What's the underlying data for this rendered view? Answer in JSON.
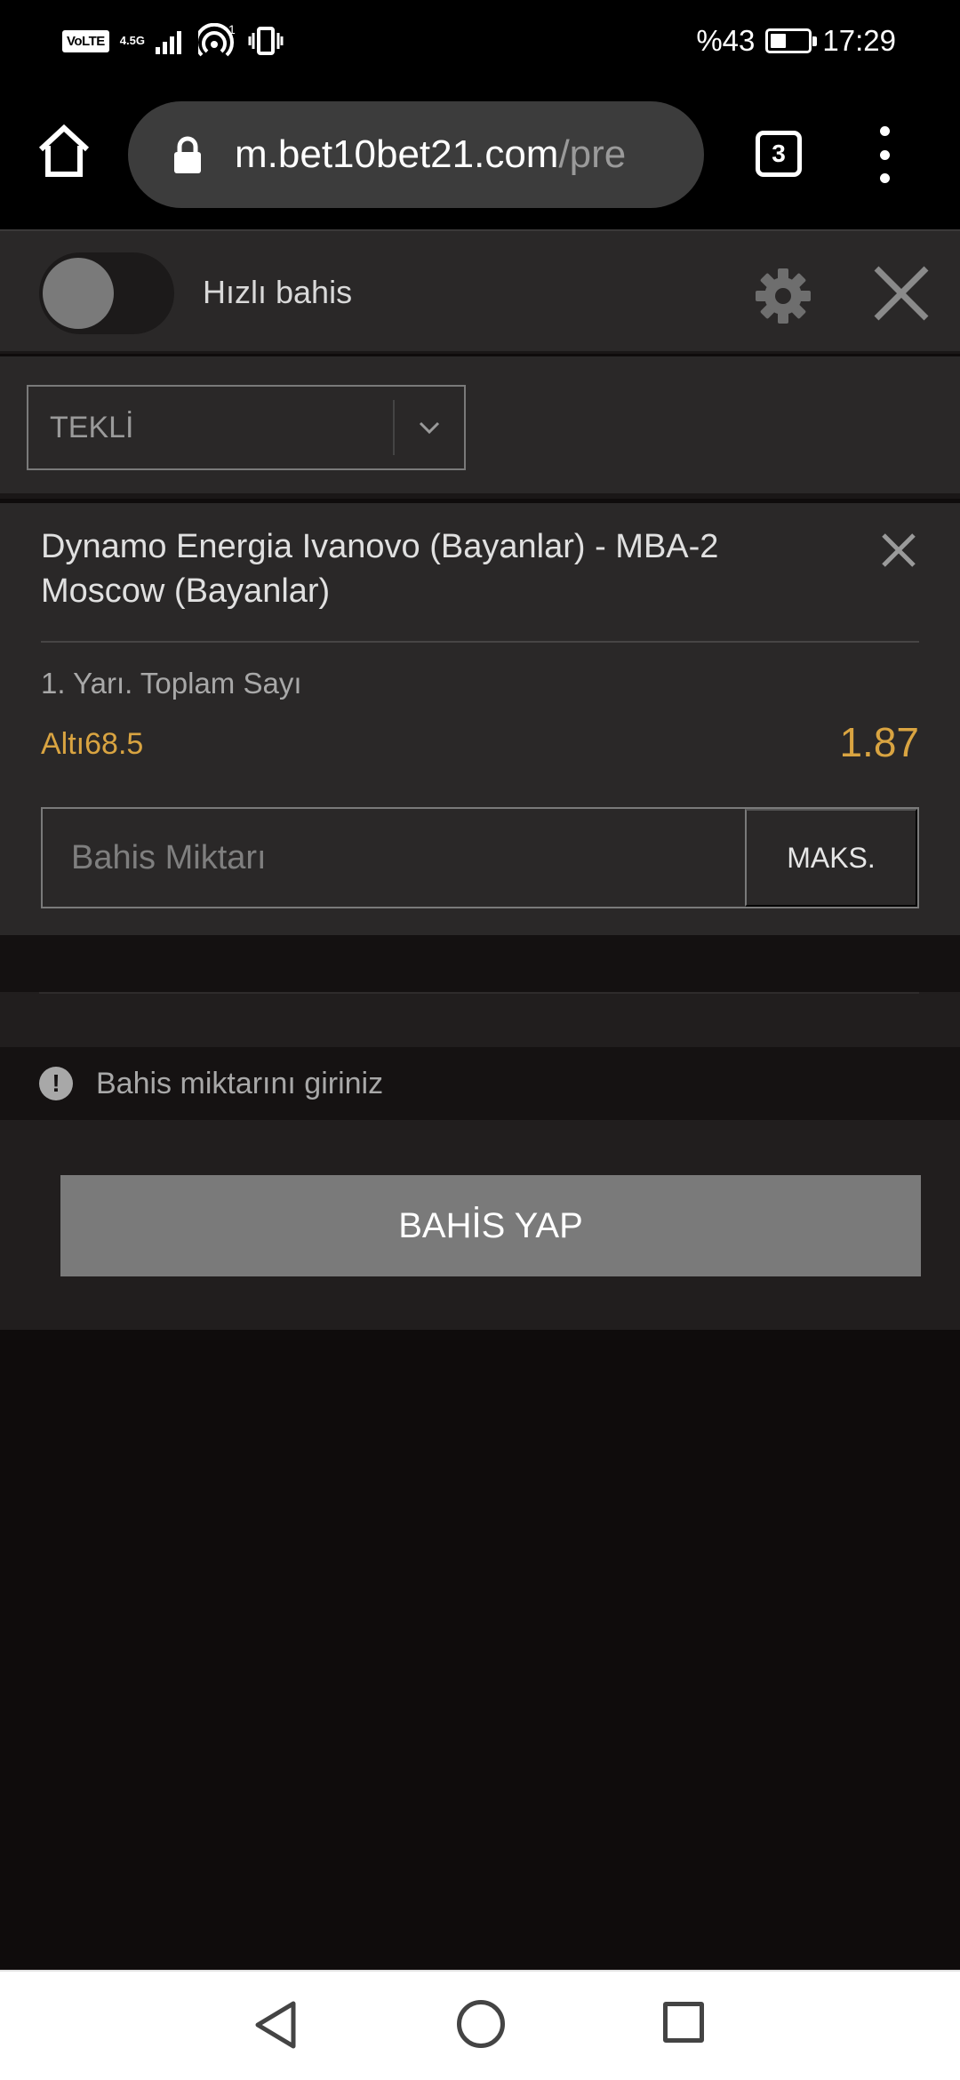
{
  "status_bar": {
    "volte": "VoLTE",
    "network": "4.5G",
    "hotspot_count": "1",
    "battery_text": "%43",
    "battery_level": 0.43,
    "time": "17:29"
  },
  "browser": {
    "url_host": "m.bet10bet21.com",
    "url_path": "/pre",
    "tab_count": "3"
  },
  "quick_bet": {
    "label": "Hızlı bahis",
    "enabled": false
  },
  "bet_type": {
    "selected": "TEKLİ"
  },
  "bet": {
    "match": "Dynamo Energia Ivanovo (Bayanlar) - MBA-2 Moscow (Bayanlar)",
    "market": "1. Yarı. Toplam Sayı",
    "selection": "Altı68.5",
    "odds": "1.87",
    "stake_placeholder": "Bahis Miktarı",
    "max_label": "MAKS."
  },
  "message": {
    "text": "Bahis miktarını giriniz"
  },
  "submit": {
    "label": "BAHİS YAP"
  },
  "colors": {
    "accent": "#d9a441",
    "panel": "#2a2828",
    "button_disabled": "#7a7a7a"
  }
}
